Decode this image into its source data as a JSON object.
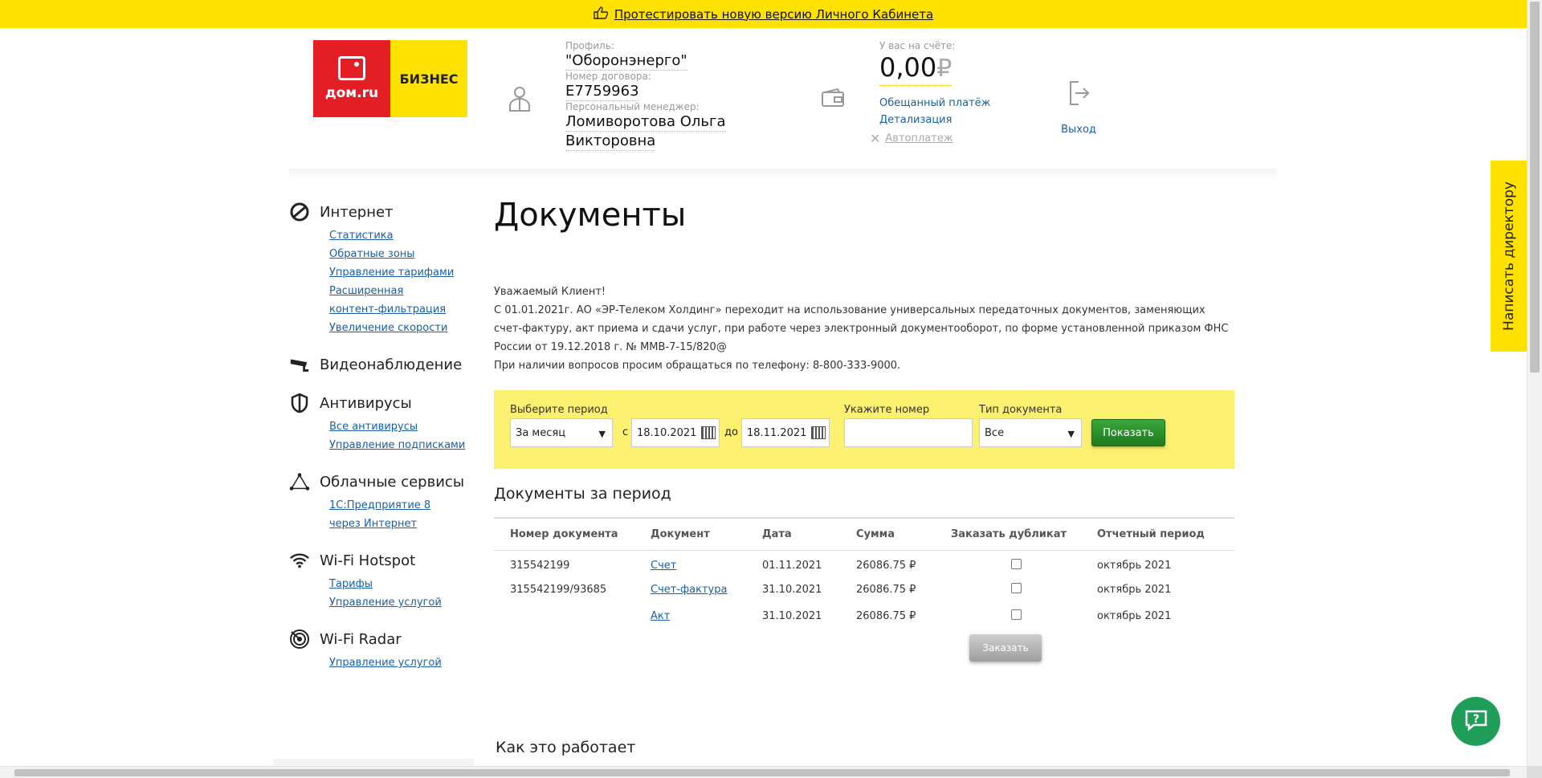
{
  "banner": {
    "text": "Протестировать новую версию Личного Кабинета",
    "icon": "thumbs-up-icon"
  },
  "logo": {
    "left_text": "дом.ru",
    "right_text": "БИЗНЕС"
  },
  "profile": {
    "profile_label": "Профиль:",
    "profile_value": "\"Оборонэнерго\"",
    "contract_label": "Номер договора:",
    "contract_value": "E7759963",
    "manager_label": "Персональный менеджер:",
    "manager_line1": "Ломиворотова Ольга",
    "manager_line2": "Викторовна"
  },
  "balance": {
    "label": "У вас на счёте:",
    "amount": "0,00",
    "currency": "₽",
    "promised_payment": "Обещанный платёж",
    "details": "Детализация",
    "autopay": "Автоплатеж"
  },
  "logout": {
    "label": "Выход"
  },
  "sidebar": [
    {
      "title": "Интернет",
      "icon": "internet-icon",
      "links": [
        "Статистика",
        "Обратные зоны",
        "Управление тарифами",
        "Расширенная контент-фильтрация",
        "Увеличение скорости"
      ]
    },
    {
      "title": "Видеонаблюдение",
      "icon": "camera-icon",
      "links": []
    },
    {
      "title": "Антивирусы",
      "icon": "shield-icon",
      "links": [
        "Все антивирусы",
        "Управление подписками"
      ]
    },
    {
      "title": "Облачные сервисы",
      "icon": "cloud-triangle-icon",
      "links": [
        "1С:Предприятие 8 через Интернет"
      ]
    },
    {
      "title": "Wi-Fi Hotspot",
      "icon": "wifi-icon",
      "links": [
        "Тарифы",
        "Управление услугой"
      ]
    },
    {
      "title": "Wi-Fi Radar",
      "icon": "radar-icon",
      "links": [
        "Управление услугой"
      ]
    }
  ],
  "main": {
    "title": "Документы",
    "notice": [
      "Уважаемый Клиент!",
      "С 01.01.2021г. АО «ЭР-Телеком Холдинг» переходит на использование универсальных передаточных документов, заменяющих счет-фактуру, акт приема и сдачи услуг, при работе через электронный документооборот, по форме установленной приказом ФНС России от 19.12.2018 г. № ММВ-7-15/820@",
      "При наличии вопросов просим обращаться по телефону: 8-800-333-9000."
    ],
    "filter": {
      "period_label": "Выберите период",
      "period_value": "За месяц",
      "from_label": "с",
      "from_date": "18.10.2021",
      "to_label": "до",
      "to_date": "18.11.2021",
      "number_label": "Укажите номер",
      "number_value": "",
      "type_label": "Тип документа",
      "type_value": "Все",
      "show_button": "Показать"
    },
    "docs_title": "Документы за период",
    "columns": [
      "Номер документа",
      "Документ",
      "Дата",
      "Сумма",
      "Заказать дубликат",
      "Отчетный период"
    ],
    "rows": [
      {
        "number": "315542199",
        "doc": "Счет",
        "date": "01.11.2021",
        "sum": "26086.75 ₽",
        "period": "октябрь 2021"
      },
      {
        "number": "315542199/93685",
        "doc": "Счет-фактура",
        "date": "31.10.2021",
        "sum": "26086.75 ₽",
        "period": "октябрь 2021"
      },
      {
        "number": "",
        "doc": "Акт",
        "date": "31.10.2021",
        "sum": "26086.75 ₽",
        "period": "октябрь 2021"
      }
    ],
    "order_button": "Заказать",
    "how_title": "Как это работает"
  },
  "side_tab": "Написать директору",
  "colors": {
    "yellow": "#ffe100",
    "filter_bg": "#fbf06f",
    "red": "#e31e24",
    "green": "#1e7a1e",
    "link": "#1a5ea8"
  }
}
